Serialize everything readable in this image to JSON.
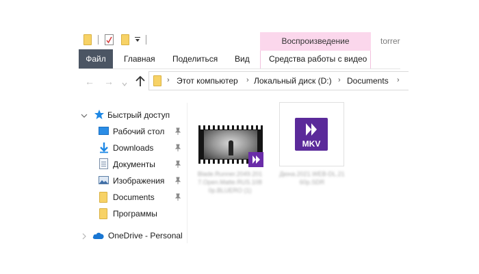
{
  "quick_access_toolbar": {
    "icons": [
      "folder-icon",
      "properties-icon",
      "new-folder-icon",
      "dropdown-arrow-icon"
    ]
  },
  "ribbon": {
    "context_group_label": "Воспроизведение",
    "context_group_color": "#fbd7ec",
    "window_title_fragment": "torrer",
    "tabs": [
      {
        "label": "Файл",
        "active": true
      },
      {
        "label": "Главная"
      },
      {
        "label": "Поделиться"
      },
      {
        "label": "Вид"
      },
      {
        "label": "Средства работы с видео"
      }
    ],
    "file_tab_color": "#4b5563"
  },
  "address_bar": {
    "breadcrumbs": [
      "Этот компьютер",
      "Локальный диск (D:)",
      "Documents"
    ],
    "separator": "›"
  },
  "nav_pane": {
    "quick_access_label": "Быстрый доступ",
    "items": [
      {
        "label": "Рабочий стол",
        "icon": "desktop-icon",
        "pinned": true
      },
      {
        "label": "Downloads",
        "icon": "downloads-arrow-icon",
        "pinned": true
      },
      {
        "label": "Документы",
        "icon": "documents-icon",
        "pinned": true
      },
      {
        "label": "Изображения",
        "icon": "pictures-icon",
        "pinned": true
      },
      {
        "label": "Documents",
        "icon": "folder-icon",
        "pinned": true
      },
      {
        "label": "Программы",
        "icon": "folder-icon",
        "pinned": false
      }
    ],
    "onedrive_label": "OneDrive - Personal"
  },
  "files": [
    {
      "name": "Blade.Runner.2049.2017.Open.Matte.RUS.1080p.BLUERO (1)",
      "type": "video",
      "badge_color": "#6a2ca8"
    },
    {
      "name": "Дюна.2021.WEB-DL.2160p.SDR",
      "type": "mkv",
      "badge_label": "MKV",
      "badge_color": "#5b2a9a"
    }
  ]
}
